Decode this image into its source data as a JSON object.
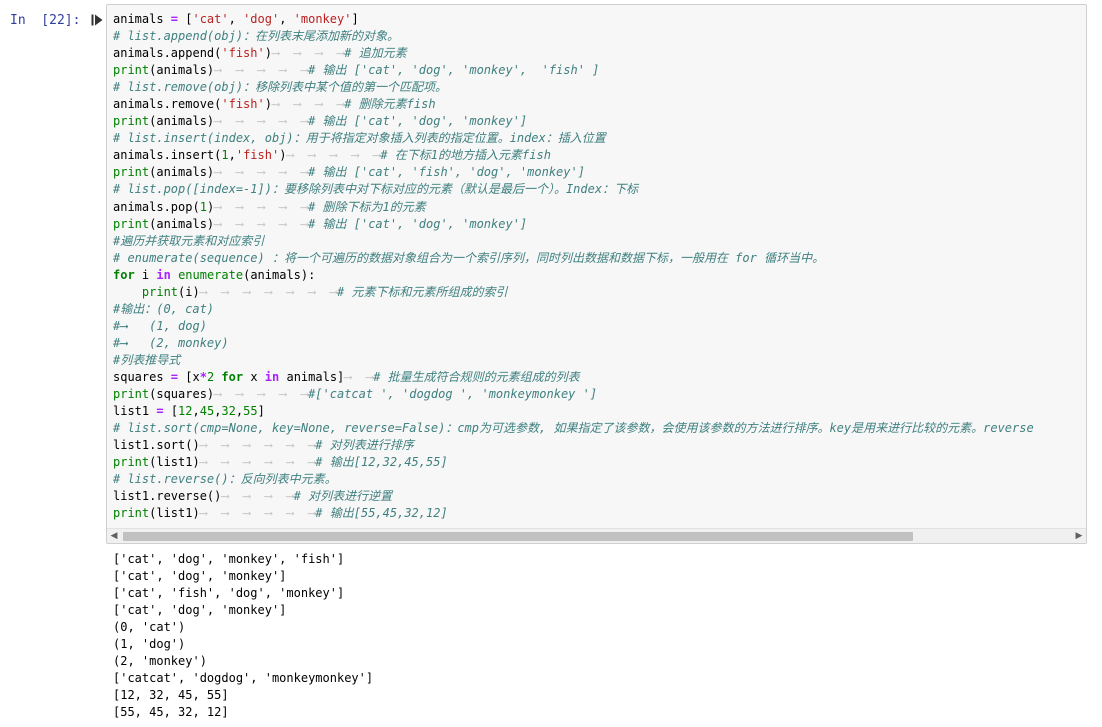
{
  "prompt": "In  [22]:",
  "code_lines": [
    [
      [
        "n",
        "animals "
      ],
      [
        "op",
        "="
      ],
      [
        "n",
        " ["
      ],
      [
        "str",
        "'cat'"
      ],
      [
        "n",
        ", "
      ],
      [
        "str",
        "'dog'"
      ],
      [
        "n",
        ", "
      ],
      [
        "str",
        "'monkey'"
      ],
      [
        "n",
        "]"
      ]
    ],
    [
      [
        "cm",
        "# list.append(obj)：在列表末尾添加新的对象。"
      ]
    ],
    [
      [
        "n",
        "animals.append("
      ],
      [
        "str",
        "'fish'"
      ],
      [
        "n",
        ")"
      ],
      [
        "tab",
        "⟶  ⟶  ⟶  ⟶"
      ],
      [
        "cm",
        "# 追加元素"
      ]
    ],
    [
      [
        "bi",
        "print"
      ],
      [
        "n",
        "(animals)"
      ],
      [
        "tab",
        "⟶  ⟶  ⟶  ⟶  ⟶"
      ],
      [
        "cm",
        "# 输出 ['cat', 'dog', 'monkey',  'fish' ]"
      ]
    ],
    [
      [
        "cm",
        "# list.remove(obj)：移除列表中某个值的第一个匹配项。"
      ]
    ],
    [
      [
        "n",
        "animals.remove("
      ],
      [
        "str",
        "'fish'"
      ],
      [
        "n",
        ")"
      ],
      [
        "tab",
        "⟶  ⟶  ⟶  ⟶"
      ],
      [
        "cm",
        "# 删除元素fish"
      ]
    ],
    [
      [
        "bi",
        "print"
      ],
      [
        "n",
        "(animals)"
      ],
      [
        "tab",
        "⟶  ⟶  ⟶  ⟶  ⟶"
      ],
      [
        "cm",
        "# 输出 ['cat', 'dog', 'monkey']"
      ]
    ],
    [
      [
        "cm",
        "# list.insert(index, obj)：用于将指定对象插入列表的指定位置。index：插入位置"
      ]
    ],
    [
      [
        "n",
        "animals.insert("
      ],
      [
        "num",
        "1"
      ],
      [
        "n",
        ","
      ],
      [
        "str",
        "'fish'"
      ],
      [
        "n",
        ")"
      ],
      [
        "tab",
        "⟶  ⟶  ⟶  ⟶  ⟶"
      ],
      [
        "cm",
        "# 在下标1的地方插入元素fish"
      ]
    ],
    [
      [
        "bi",
        "print"
      ],
      [
        "n",
        "(animals)"
      ],
      [
        "tab",
        "⟶  ⟶  ⟶  ⟶  ⟶"
      ],
      [
        "cm",
        "# 输出 ['cat', 'fish', 'dog', 'monkey']"
      ]
    ],
    [
      [
        "cm",
        "# list.pop([index=-1])：要移除列表中对下标对应的元素（默认是最后一个）。Index：下标"
      ]
    ],
    [
      [
        "n",
        "animals.pop("
      ],
      [
        "num",
        "1"
      ],
      [
        "n",
        ")"
      ],
      [
        "tab",
        "⟶  ⟶  ⟶  ⟶  ⟶"
      ],
      [
        "cm",
        "# 删除下标为1的元素"
      ]
    ],
    [
      [
        "bi",
        "print"
      ],
      [
        "n",
        "(animals)"
      ],
      [
        "tab",
        "⟶  ⟶  ⟶  ⟶  ⟶"
      ],
      [
        "cm",
        "# 输出 ['cat', 'dog', 'monkey']"
      ]
    ],
    [
      [
        "cm",
        "#遍历并获取元素和对应索引"
      ]
    ],
    [
      [
        "cm",
        "# enumerate(sequence) ：将一个可遍历的数据对象组合为一个索引序列，同时列出数据和数据下标，一般用在 for 循环当中。"
      ]
    ],
    [
      [
        "kw",
        "for"
      ],
      [
        "n",
        " i "
      ],
      [
        "op",
        "in"
      ],
      [
        "n",
        " "
      ],
      [
        "bi",
        "enumerate"
      ],
      [
        "n",
        "(animals):"
      ]
    ],
    [
      [
        "n",
        "    "
      ],
      [
        "bi",
        "print"
      ],
      [
        "n",
        "(i)"
      ],
      [
        "tab",
        "⟶  ⟶  ⟶  ⟶  ⟶  ⟶  ⟶"
      ],
      [
        "cm",
        "# 元素下标和元素所组成的索引"
      ]
    ],
    [
      [
        "cm",
        "#输出：(0, cat)"
      ]
    ],
    [
      [
        "cm",
        "#⟶   (1, dog)"
      ]
    ],
    [
      [
        "cm",
        "#⟶   (2, monkey)"
      ]
    ],
    [
      [
        "cm",
        "#列表推导式"
      ]
    ],
    [
      [
        "n",
        "squares "
      ],
      [
        "op",
        "="
      ],
      [
        "n",
        " [x"
      ],
      [
        "op",
        "*"
      ],
      [
        "num",
        "2"
      ],
      [
        "n",
        " "
      ],
      [
        "kw",
        "for"
      ],
      [
        "n",
        " x "
      ],
      [
        "op",
        "in"
      ],
      [
        "n",
        " animals]"
      ],
      [
        "tab",
        "⟶  ⟶"
      ],
      [
        "cm",
        "# 批量生成符合规则的元素组成的列表"
      ]
    ],
    [
      [
        "bi",
        "print"
      ],
      [
        "n",
        "(squares)"
      ],
      [
        "tab",
        "⟶  ⟶  ⟶  ⟶  ⟶"
      ],
      [
        "cm",
        "#['catcat ', 'dogdog ', 'monkeymonkey ']"
      ]
    ],
    [
      [
        "n",
        "list1 "
      ],
      [
        "op",
        "="
      ],
      [
        "n",
        " ["
      ],
      [
        "num",
        "12"
      ],
      [
        "n",
        ","
      ],
      [
        "num",
        "45"
      ],
      [
        "n",
        ","
      ],
      [
        "num",
        "32"
      ],
      [
        "n",
        ","
      ],
      [
        "num",
        "55"
      ],
      [
        "n",
        "]"
      ]
    ],
    [
      [
        "cm",
        "# list.sort(cmp=None, key=None, reverse=False)：cmp为可选参数, 如果指定了该参数，会使用该参数的方法进行排序。key是用来进行比较的元素。reverse"
      ]
    ],
    [
      [
        "n",
        "list1.sort()"
      ],
      [
        "tab",
        "⟶  ⟶  ⟶  ⟶  ⟶  ⟶"
      ],
      [
        "cm",
        "# 对列表进行排序"
      ]
    ],
    [
      [
        "bi",
        "print"
      ],
      [
        "n",
        "(list1)"
      ],
      [
        "tab",
        "⟶  ⟶  ⟶  ⟶  ⟶  ⟶"
      ],
      [
        "cm",
        "# 输出[12,32,45,55]"
      ]
    ],
    [
      [
        "cm",
        "# list.reverse()：反向列表中元素。"
      ]
    ],
    [
      [
        "n",
        "list1.reverse()"
      ],
      [
        "tab",
        "⟶  ⟶  ⟶  ⟶"
      ],
      [
        "cm",
        "# 对列表进行逆置"
      ]
    ],
    [
      [
        "bi",
        "print"
      ],
      [
        "n",
        "(list1)"
      ],
      [
        "tab",
        "⟶  ⟶  ⟶  ⟶  ⟶  ⟶"
      ],
      [
        "cm",
        "# 输出[55,45,32,12]"
      ]
    ]
  ],
  "output_lines": [
    "['cat', 'dog', 'monkey', 'fish']",
    "['cat', 'dog', 'monkey']",
    "['cat', 'fish', 'dog', 'monkey']",
    "['cat', 'dog', 'monkey']",
    "(0, 'cat')",
    "(1, 'dog')",
    "(2, 'monkey')",
    "['catcat', 'dogdog', 'monkeymonkey']",
    "[12, 32, 45, 55]",
    "[55, 45, 32, 12]"
  ],
  "scroll": {
    "left_arrow": "◀",
    "right_arrow": "▶"
  },
  "colors": {
    "prompt": "#303f9f",
    "keyword": "#008000",
    "string": "#ba2121",
    "comment": "#408080",
    "operator": "#aa22ff",
    "cell_background": "#f7f7f7"
  },
  "icons": {
    "run": "run-cell-icon"
  }
}
